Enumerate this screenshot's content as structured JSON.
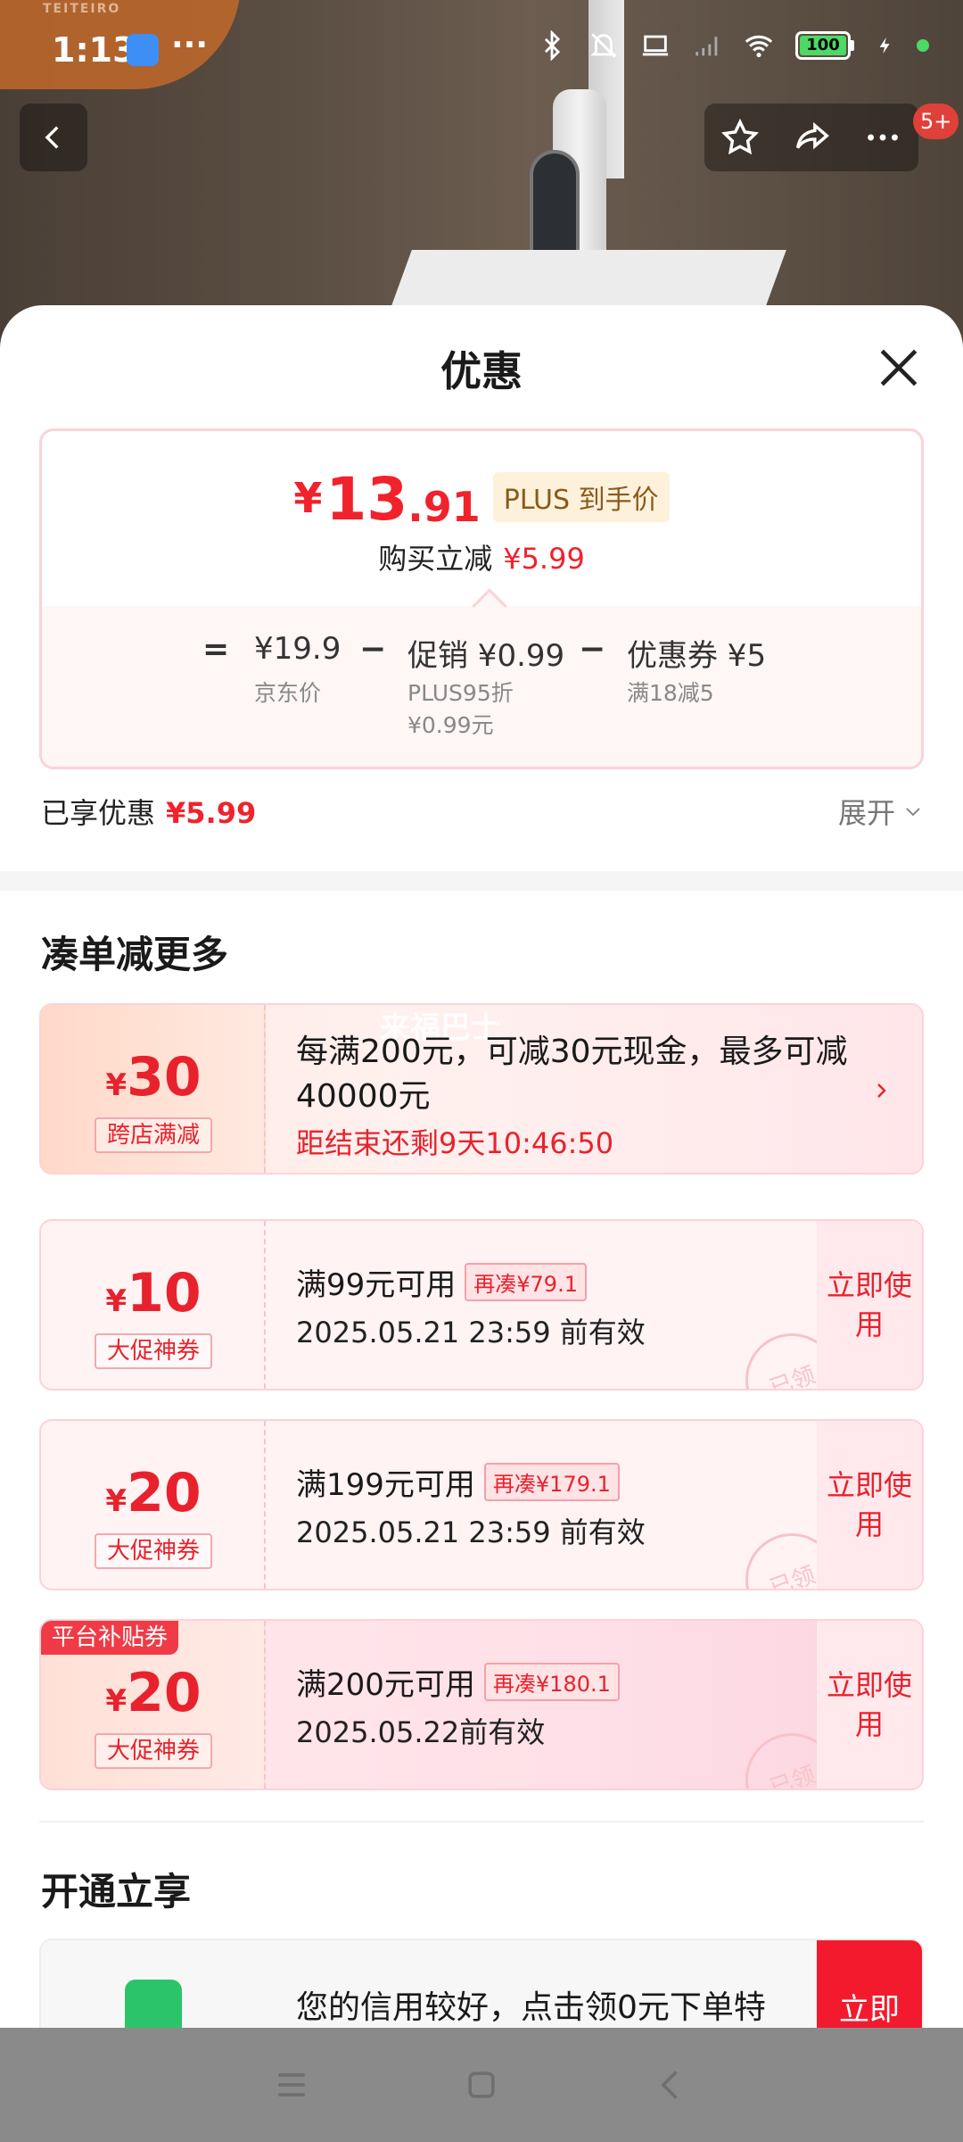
{
  "status_bar": {
    "time": "1:13",
    "more": "···",
    "battery": "100"
  },
  "background": {
    "brand": "TEITEIRO"
  },
  "product_nav": {
    "badge": "5+"
  },
  "sheet": {
    "title": "优惠"
  },
  "price_card": {
    "yen": "¥",
    "price_int": "13",
    "price_dec": ".91",
    "plus_tag": "PLUS 到手价",
    "buy_reduce_label": "购买立减",
    "buy_reduce_value": "¥5.99",
    "eq": "=",
    "jd_price": "¥19.9",
    "jd_price_label": "京东价",
    "minus": "−",
    "promo": "促销 ¥0.99",
    "promo_sub1": "PLUS95折",
    "promo_sub2": "¥0.99元",
    "coupon": "优惠券 ¥5",
    "coupon_sub": "满18减5"
  },
  "enjoyed": {
    "label": "已享优惠",
    "value": "¥5.99",
    "expand": "展开"
  },
  "section_more": {
    "title": "凑单减更多"
  },
  "promo_card": {
    "yen": "¥",
    "amount": "30",
    "tag": "跨店满减",
    "desc": "每满200元，可减30元现金，最多可减40000元",
    "countdown": "距结束还剩9天10:46:50",
    "watermark": "来福巴士"
  },
  "coupons": [
    {
      "yen": "¥",
      "amount": "10",
      "tag": "大促神券",
      "desc": "满99元可用",
      "chip": "再凑¥79.1",
      "valid": "2025.05.21 23:59 前有效",
      "use": "立即使用",
      "stamp": "已领"
    },
    {
      "yen": "¥",
      "amount": "20",
      "tag": "大促神券",
      "desc": "满199元可用",
      "chip": "再凑¥179.1",
      "valid": "2025.05.21 23:59 前有效",
      "use": "立即使用",
      "stamp": "已领"
    },
    {
      "yen": "¥",
      "amount": "20",
      "tag": "大促神券",
      "desc": "满200元可用",
      "chip": "再凑¥180.1",
      "valid": "2025.05.22前有效",
      "use": "立即使用",
      "stamp": "已领",
      "platform_tag": "平台补贴券"
    }
  ],
  "section_open": {
    "title": "开通立享",
    "text": "您的信用较好，点击领0元下单特",
    "button": "立即"
  }
}
